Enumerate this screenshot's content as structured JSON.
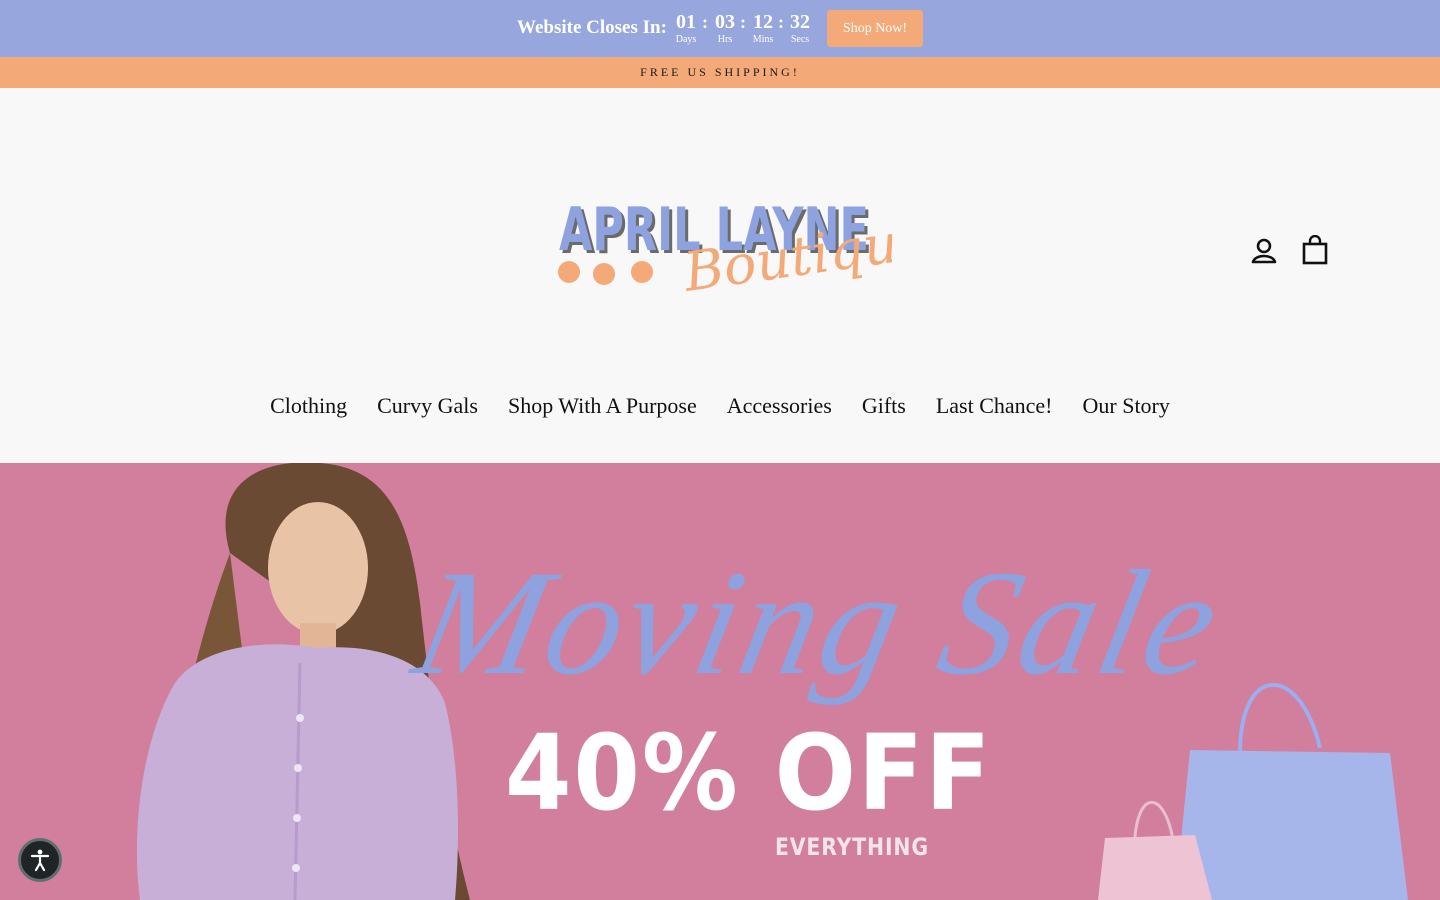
{
  "countdown": {
    "title": "Website Closes In:",
    "units": [
      {
        "value": "01",
        "label": "Days"
      },
      {
        "value": "03",
        "label": "Hrs"
      },
      {
        "value": "12",
        "label": "Mins"
      },
      {
        "value": "32",
        "label": "Secs"
      }
    ],
    "separator": ":",
    "cta_label": "Shop Now!"
  },
  "shipping": {
    "text": "FREE US SHIPPING!"
  },
  "logo": {
    "line1": "APRIL LAYNE",
    "line2": "Boutique"
  },
  "header_icons": {
    "account": "user-icon",
    "cart": "shopping-bag-icon"
  },
  "nav": {
    "items": [
      "Clothing",
      "Curvy Gals",
      "Shop With A Purpose",
      "Accessories",
      "Gifts",
      "Last Chance!",
      "Our Story"
    ]
  },
  "hero": {
    "script_text": "Moving Sale",
    "offer_text": "40% OFF",
    "sub_text": "EVERYTHING"
  },
  "accessibility": {
    "icon": "accessibility-icon"
  },
  "colors": {
    "countdown_bg": "#97a6dd",
    "accent_orange": "#f3a978",
    "hero_pink": "#d17f9d",
    "script_blue": "#8ea2e0"
  }
}
